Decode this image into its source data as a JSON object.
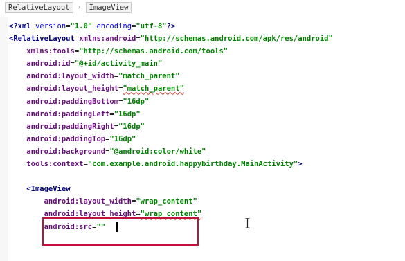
{
  "breadcrumb": {
    "items": [
      "RelativeLayout",
      "ImageView"
    ]
  },
  "code_lines": [
    {
      "indent": "",
      "parts": [
        {
          "t": "pi",
          "s": "<?xml "
        },
        {
          "t": "attr",
          "s": "version"
        },
        {
          "t": "punct",
          "s": "="
        },
        {
          "t": "val",
          "s": "\"1.0\""
        },
        {
          "t": "punct",
          "s": " "
        },
        {
          "t": "attr",
          "s": "encoding"
        },
        {
          "t": "punct",
          "s": "="
        },
        {
          "t": "val",
          "s": "\"utf-8\""
        },
        {
          "t": "pi",
          "s": "?>"
        }
      ]
    },
    {
      "indent": "",
      "parts": [
        {
          "t": "tag",
          "s": "<RelativeLayout "
        },
        {
          "t": "attr-ns",
          "s": "xmlns:android"
        },
        {
          "t": "punct",
          "s": "="
        },
        {
          "t": "val",
          "s": "\"http://schemas.android.com/apk/res/android\""
        }
      ]
    },
    {
      "indent": "    ",
      "parts": [
        {
          "t": "attr-ns",
          "s": "xmlns:tools"
        },
        {
          "t": "punct",
          "s": "="
        },
        {
          "t": "val",
          "s": "\"http://schemas.android.com/tools\""
        }
      ]
    },
    {
      "indent": "    ",
      "parts": [
        {
          "t": "attr-ns",
          "s": "android:id"
        },
        {
          "t": "punct",
          "s": "="
        },
        {
          "t": "val",
          "s": "\"@+id/activity_main\""
        }
      ]
    },
    {
      "indent": "    ",
      "parts": [
        {
          "t": "attr-ns",
          "s": "android:layout_width"
        },
        {
          "t": "punct",
          "s": "="
        },
        {
          "t": "val",
          "s": "\"match_parent\""
        }
      ]
    },
    {
      "indent": "    ",
      "parts": [
        {
          "t": "attr-ns",
          "s": "android:layout_height"
        },
        {
          "t": "punct",
          "s": "="
        },
        {
          "t": "val",
          "s": "\"match_parent\""
        }
      ]
    },
    {
      "indent": "    ",
      "parts": [
        {
          "t": "attr-ns",
          "s": "android:paddingBottom"
        },
        {
          "t": "punct",
          "s": "="
        },
        {
          "t": "val",
          "s": "\"16dp\""
        }
      ]
    },
    {
      "indent": "    ",
      "parts": [
        {
          "t": "attr-ns",
          "s": "android:paddingLeft"
        },
        {
          "t": "punct",
          "s": "="
        },
        {
          "t": "val",
          "s": "\"16dp\""
        }
      ]
    },
    {
      "indent": "    ",
      "parts": [
        {
          "t": "attr-ns",
          "s": "android:paddingRight"
        },
        {
          "t": "punct",
          "s": "="
        },
        {
          "t": "val",
          "s": "\"16dp\""
        }
      ]
    },
    {
      "indent": "    ",
      "parts": [
        {
          "t": "attr-ns",
          "s": "android:paddingTop"
        },
        {
          "t": "punct",
          "s": "="
        },
        {
          "t": "val",
          "s": "\"16dp\""
        }
      ]
    },
    {
      "indent": "    ",
      "parts": [
        {
          "t": "attr-ns",
          "s": "android:background"
        },
        {
          "t": "punct",
          "s": "="
        },
        {
          "t": "val",
          "s": "\"@android:color/white\""
        }
      ]
    },
    {
      "indent": "    ",
      "parts": [
        {
          "t": "attr-ns",
          "s": "tools:context"
        },
        {
          "t": "punct",
          "s": "="
        },
        {
          "t": "val",
          "s": "\"com.example.android.happybirthday.MainActivity\""
        },
        {
          "t": "tag",
          "s": ">"
        }
      ]
    },
    {
      "indent": "",
      "parts": []
    },
    {
      "indent": "    ",
      "parts": [
        {
          "t": "tag",
          "s": "<ImageView"
        }
      ]
    },
    {
      "indent": "        ",
      "parts": [
        {
          "t": "attr-ns",
          "s": "android:layout_width"
        },
        {
          "t": "punct",
          "s": "="
        },
        {
          "t": "val",
          "s": "\"wrap_content\""
        }
      ]
    },
    {
      "indent": "        ",
      "parts": [
        {
          "t": "attr-ns",
          "s": "android:layout_height"
        },
        {
          "t": "punct",
          "s": "="
        },
        {
          "t": "val",
          "s": "\"wrap_content\""
        }
      ]
    },
    {
      "indent": "        ",
      "parts": [
        {
          "t": "attr-ns",
          "s": "android:src"
        },
        {
          "t": "punct",
          "s": "="
        },
        {
          "t": "val",
          "s": "\"\""
        }
      ]
    }
  ],
  "colors": {
    "tag": "#000080",
    "attribute": "#660e7a",
    "value": "#008000",
    "highlight_border": "#c0133a"
  },
  "icons": {
    "cursor": "text-ibeam-cursor-icon"
  }
}
